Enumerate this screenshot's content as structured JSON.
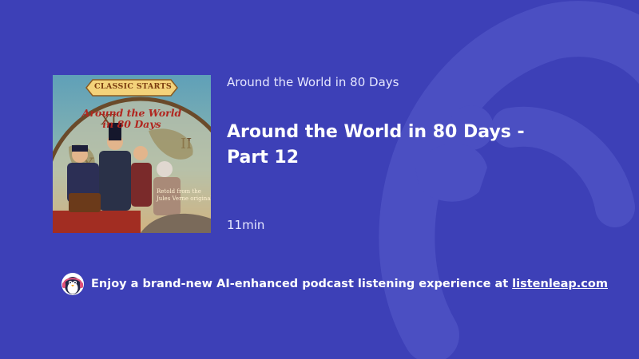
{
  "podcast": {
    "show_name": "Around the World in 80 Days",
    "episode_title": "Around the World in 80 Days - Part 12",
    "duration": "11min"
  },
  "cover": {
    "series": "CLASSIC STARTS",
    "title_line1": "Around the World",
    "title_line2": "in 80 Days",
    "retold_line1": "Retold from the",
    "retold_line2": "Jules Verne original"
  },
  "promo": {
    "text": "Enjoy a brand-new AI-enhanced podcast listening experience at",
    "link": "listenleap.com",
    "logo_icon": "penguin-headphones-icon"
  },
  "colors": {
    "background": "#3d40b7",
    "watermark": "#4a4dc0"
  }
}
